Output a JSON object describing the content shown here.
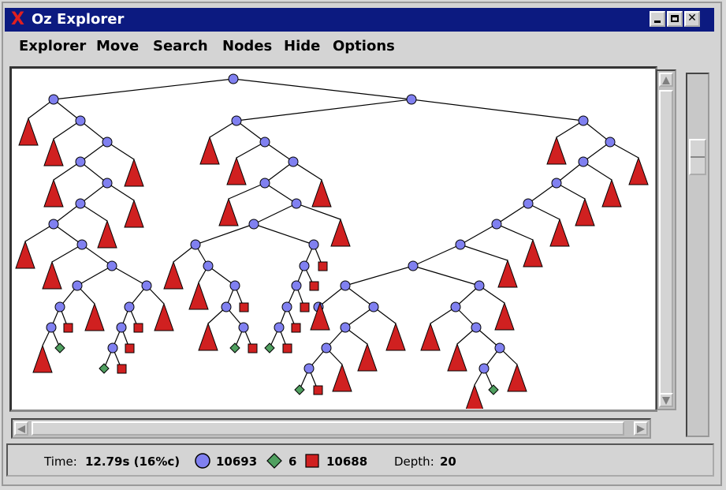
{
  "window": {
    "title": "Oz Explorer",
    "close_mark": "X",
    "buttons": [
      "minimize",
      "maximize",
      "close"
    ]
  },
  "menu": {
    "items": [
      "Explorer",
      "Move",
      "Search",
      "Nodes",
      "Hide",
      "Options"
    ]
  },
  "status": {
    "time_label": "Time:",
    "time_value": "12.79s (16%c)",
    "choice_count": "10693",
    "solved_count": "6",
    "failed_count": "10688",
    "depth_label": "Depth:",
    "depth_value": "20"
  },
  "colors": {
    "choice": "#8080f0",
    "solved": "#50a060",
    "failed": "#d02020",
    "titlebar": "#0c1a80"
  },
  "icons": {
    "choice": "circle-icon",
    "solved": "diamond-icon",
    "failed": "square-icon",
    "hidden_failed": "triangle-icon"
  }
}
